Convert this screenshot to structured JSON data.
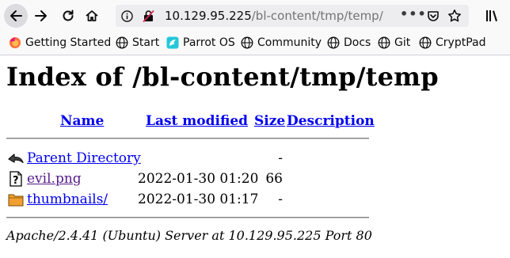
{
  "browser": {
    "url_host": "10.129.95.225",
    "url_path": "/bl-content/tmp/temp/",
    "bookmarks": [
      {
        "label": "Getting Started",
        "icon": "firefox-icon"
      },
      {
        "label": "Start",
        "icon": "globe-icon"
      },
      {
        "label": "Parrot OS",
        "icon": "parrot-icon"
      },
      {
        "label": "Community",
        "icon": "globe-icon"
      },
      {
        "label": "Docs",
        "icon": "globe-icon"
      },
      {
        "label": "Git",
        "icon": "globe-icon"
      },
      {
        "label": "CryptPad",
        "icon": "globe-icon"
      }
    ]
  },
  "page": {
    "title": "Index of /bl-content/tmp/temp",
    "columns": {
      "name": "Name",
      "last_modified": "Last modified",
      "size": "Size",
      "description": "Description"
    },
    "rows": [
      {
        "name": "Parent Directory",
        "modified": "",
        "size": "-",
        "icon": "back-arrow-icon"
      },
      {
        "name": "evil.png",
        "modified": "2022-01-30 01:20",
        "size": "66",
        "icon": "unknown-file-icon"
      },
      {
        "name": "thumbnails/",
        "modified": "2022-01-30 01:17",
        "size": "-",
        "icon": "folder-icon"
      }
    ],
    "footer": "Apache/2.4.41 (Ubuntu) Server at 10.129.95.225 Port 80"
  }
}
